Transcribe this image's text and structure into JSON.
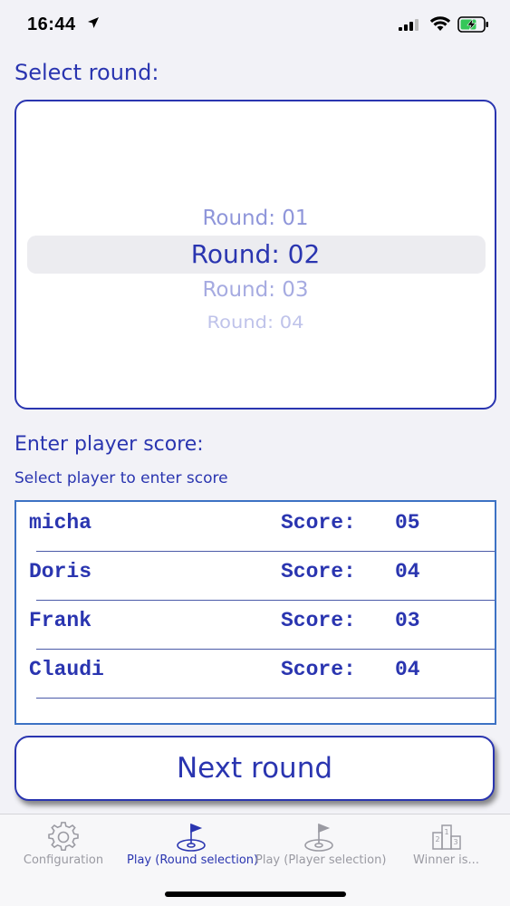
{
  "status_bar": {
    "time": "16:44"
  },
  "round_picker": {
    "title": "Select round:",
    "items": [
      "Round: 01",
      "Round: 02",
      "Round: 03",
      "Round: 04"
    ],
    "selected": "Round: 02"
  },
  "score_section": {
    "title": "Enter player score:",
    "subtitle": "Select player to enter score",
    "players": [
      {
        "name": "micha",
        "score_label": "Score:",
        "score": "05"
      },
      {
        "name": "Doris",
        "score_label": "Score:",
        "score": "04"
      },
      {
        "name": "Frank",
        "score_label": "Score:",
        "score": "03"
      },
      {
        "name": "Claudi",
        "score_label": "Score:",
        "score": "04"
      }
    ]
  },
  "next_button": {
    "label": "Next round"
  },
  "tab_bar": {
    "tabs": [
      {
        "label": "Configuration",
        "icon": "gear-icon"
      },
      {
        "label": "Play (Round selection)",
        "icon": "golf-hole-icon"
      },
      {
        "label": "Play (Player selection)",
        "icon": "golf-hole-icon"
      },
      {
        "label": "Winner is...",
        "icon": "podium-icon"
      }
    ],
    "active_index": 1
  },
  "colors": {
    "accent": "#2a35b0",
    "inactive": "#9a9aa2",
    "background": "#f2f2f7"
  }
}
